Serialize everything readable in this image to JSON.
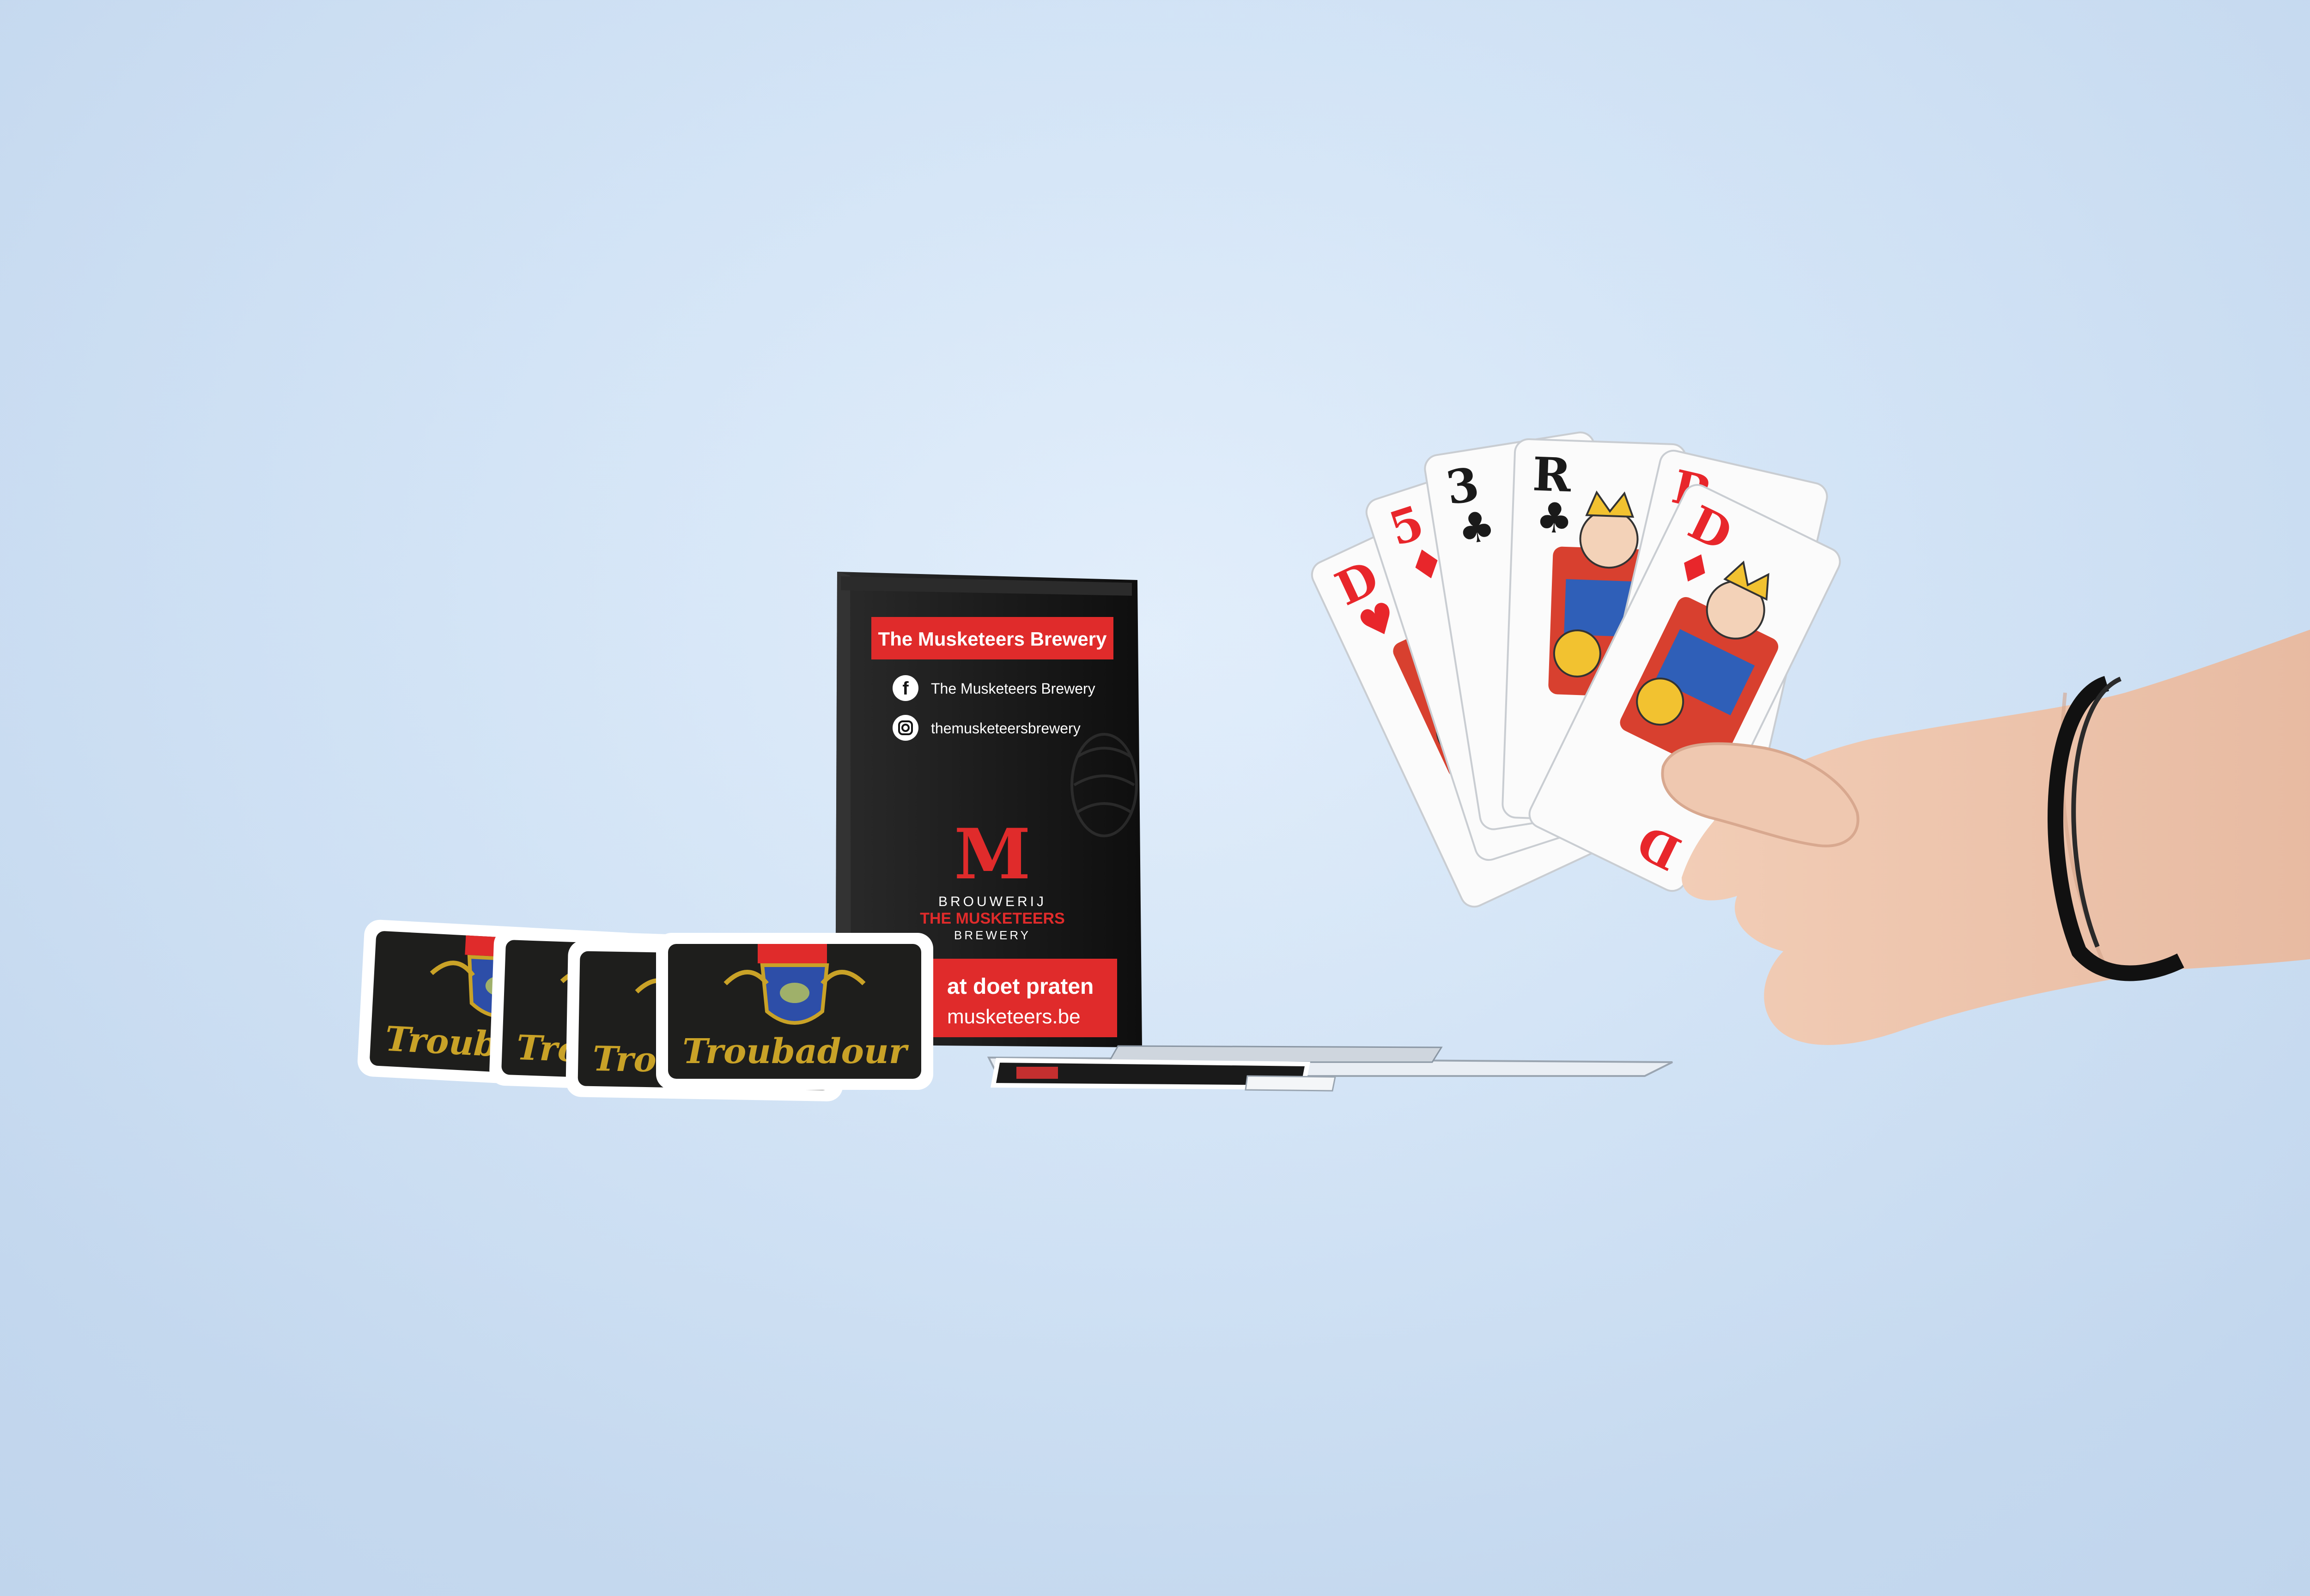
{
  "box": {
    "title": "The Musketeers Brewery",
    "facebook": "The Musketeers Brewery",
    "instagram": "themusketeersbrewery",
    "logo_letter": "M",
    "logo_line1": "BROUWERIJ",
    "logo_line2": "THE MUSKETEERS",
    "logo_line3": "BREWERY",
    "slogan": "at doet praten",
    "website": "musketeers.be"
  },
  "spread_cards": {
    "brand": "Troubadour",
    "count": 4
  },
  "hand": {
    "cards": [
      {
        "rank": "D",
        "suit": "♥",
        "color": "#e8262b"
      },
      {
        "rank": "5",
        "suit": "♦",
        "color": "#e8262b"
      },
      {
        "rank": "3",
        "suit": "♣",
        "color": "#1a1a1a"
      },
      {
        "rank": "R",
        "suit": "♣",
        "color": "#1a1a1a"
      },
      {
        "rank": "R",
        "suit": "♦",
        "color": "#e8262b"
      },
      {
        "rank": "D",
        "suit": "♦",
        "color": "#e8262b"
      }
    ]
  },
  "colors": {
    "background": "#d6e6f7",
    "box_black": "#141414",
    "brand_red": "#e02b2b",
    "card_back": "#1e1e1c",
    "gold": "#c9a227",
    "skin": "#ecc4ad"
  }
}
